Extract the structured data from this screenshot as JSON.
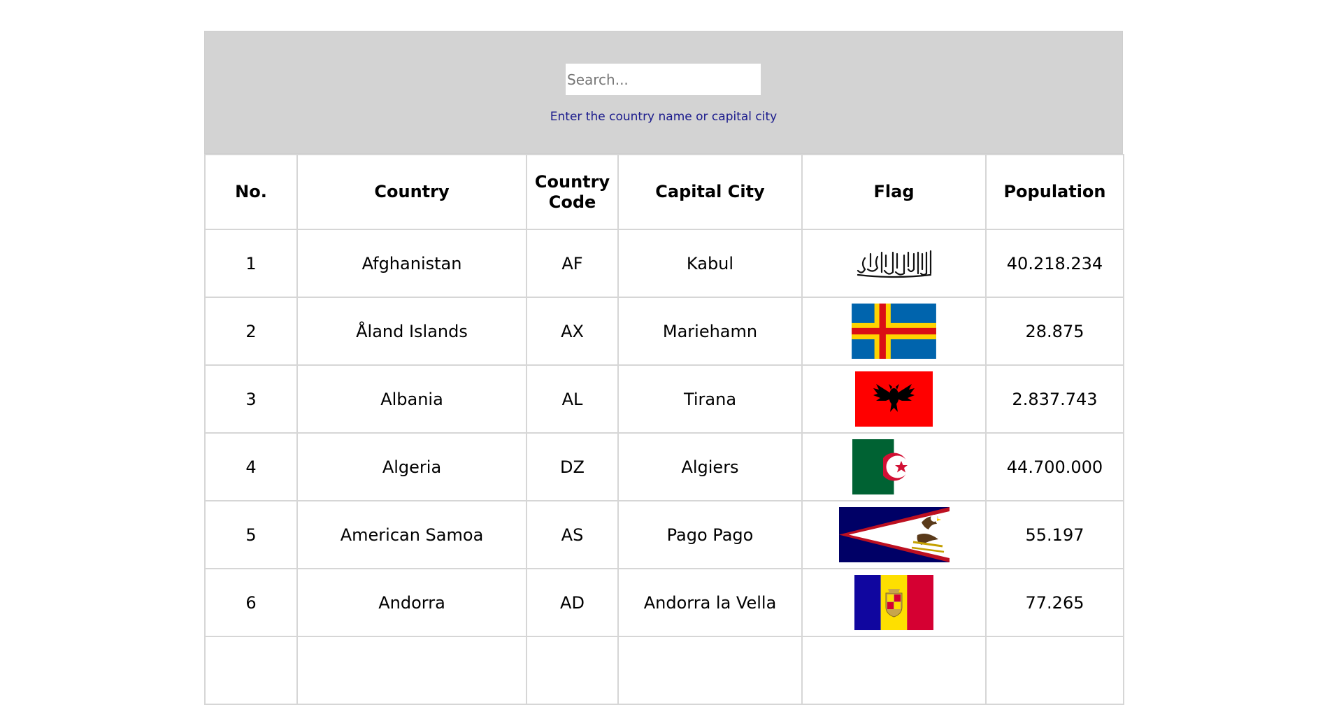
{
  "search": {
    "placeholder": "Search...",
    "value": "",
    "hint": "Enter the country name or capital city"
  },
  "table": {
    "headers": [
      "No.",
      "Country",
      "Country Code",
      "Capital City",
      "Flag",
      "Population"
    ],
    "rows": [
      {
        "no": "1",
        "country": "Afghanistan",
        "code": "AF",
        "capital": "Kabul",
        "flag": "afghanistan-flag-icon",
        "population": "40.218.234"
      },
      {
        "no": "2",
        "country": "Åland Islands",
        "code": "AX",
        "capital": "Mariehamn",
        "flag": "aland-islands-flag-icon",
        "population": "28.875"
      },
      {
        "no": "3",
        "country": "Albania",
        "code": "AL",
        "capital": "Tirana",
        "flag": "albania-flag-icon",
        "population": "2.837.743"
      },
      {
        "no": "4",
        "country": "Algeria",
        "code": "DZ",
        "capital": "Algiers",
        "flag": "algeria-flag-icon",
        "population": "44.700.000"
      },
      {
        "no": "5",
        "country": "American Samoa",
        "code": "AS",
        "capital": "Pago Pago",
        "flag": "american-samoa-flag-icon",
        "population": "55.197"
      },
      {
        "no": "6",
        "country": "Andorra",
        "code": "AD",
        "capital": "Andorra la Vella",
        "flag": "andorra-flag-icon",
        "population": "77.265"
      },
      {
        "no": "",
        "country": "",
        "code": "",
        "capital": "",
        "flag": "",
        "population": ""
      }
    ]
  },
  "colors": {
    "panel_background": "#d3d3d3",
    "hint_text": "#1a1a8c",
    "table_border": "#d6d6d6"
  }
}
